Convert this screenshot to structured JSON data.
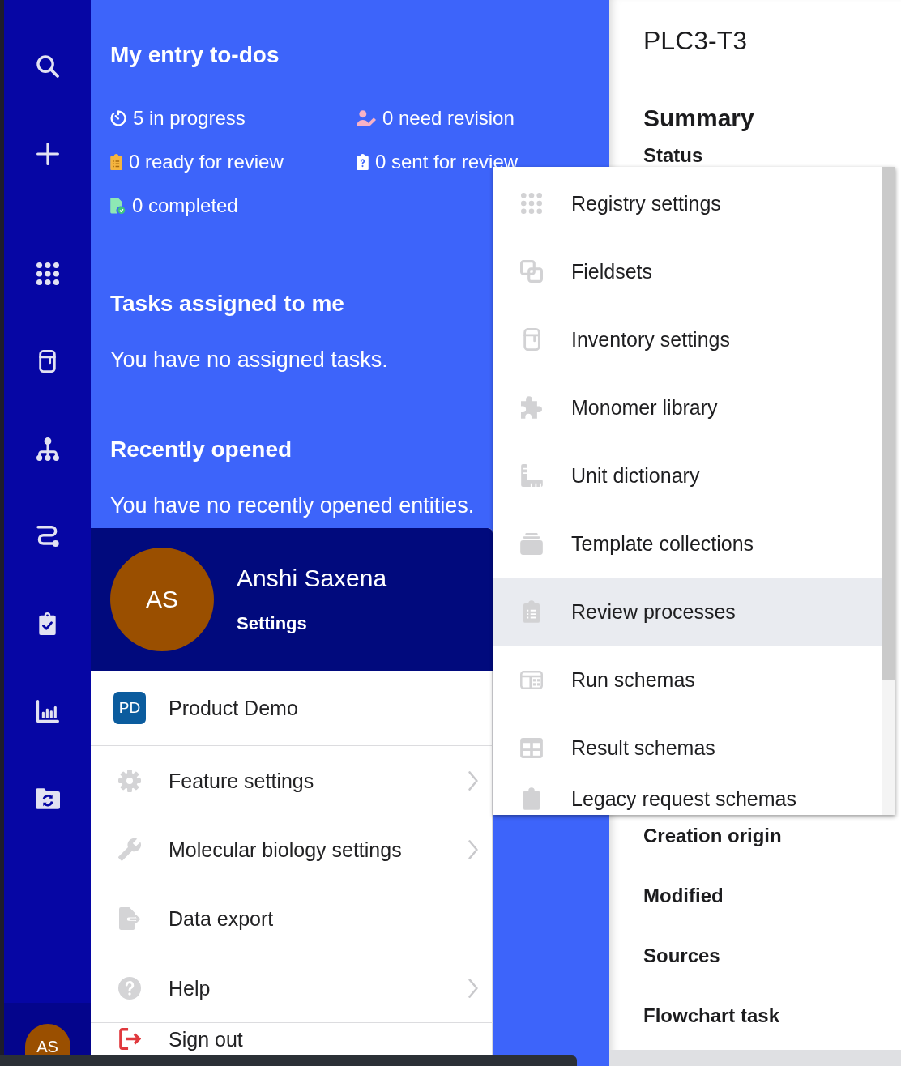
{
  "sidebar": {
    "avatar_initials": "AS"
  },
  "todos": {
    "title": "My entry to-dos",
    "stats": [
      {
        "kind": "progress",
        "label": "5 in progress"
      },
      {
        "kind": "revision",
        "label": "0 need revision"
      },
      {
        "kind": "ready",
        "label": "0 ready for review"
      },
      {
        "kind": "sent",
        "label": "0 sent for review"
      },
      {
        "kind": "completed",
        "label": "0 completed"
      }
    ]
  },
  "tasks": {
    "title": "Tasks assigned to me",
    "empty_text": "You have no assigned tasks."
  },
  "recent": {
    "title": "Recently opened",
    "empty_text": "You have no recently opened entities."
  },
  "entity": {
    "title": "PLC3-T3",
    "section_title": "Summary",
    "fields": [
      {
        "label": "Status"
      },
      {
        "label": "Creation origin"
      },
      {
        "label": "Modified"
      },
      {
        "label": "Sources"
      },
      {
        "label": "Flowchart task"
      }
    ]
  },
  "user_menu": {
    "initials": "AS",
    "name": "Anshi Saxena",
    "settings_link": "Settings",
    "sections": [
      {
        "items": [
          {
            "kind": "organization",
            "badge": "PD",
            "label": "Product Demo",
            "has_submenu": false
          }
        ]
      },
      {
        "items": [
          {
            "kind": "gear",
            "label": "Feature settings",
            "has_submenu": true
          },
          {
            "kind": "wrench",
            "label": "Molecular biology settings",
            "has_submenu": true
          },
          {
            "kind": "export",
            "label": "Data export",
            "has_submenu": false
          }
        ]
      },
      {
        "items": [
          {
            "kind": "help",
            "label": "Help",
            "has_submenu": true
          }
        ]
      },
      {
        "items": [
          {
            "kind": "signout",
            "label": "Sign out",
            "has_submenu": false
          }
        ]
      }
    ]
  },
  "settings_menu": {
    "items": [
      {
        "kind": "dots",
        "label": "Registry settings",
        "selected": false
      },
      {
        "kind": "squares",
        "label": "Fieldsets",
        "selected": false
      },
      {
        "kind": "cabinet",
        "label": "Inventory settings",
        "selected": false
      },
      {
        "kind": "puzzle",
        "label": "Monomer library",
        "selected": false
      },
      {
        "kind": "ruler",
        "label": "Unit dictionary",
        "selected": false
      },
      {
        "kind": "stack",
        "label": "Template collections",
        "selected": false
      },
      {
        "kind": "clipboard",
        "label": "Review processes",
        "selected": true
      },
      {
        "kind": "card",
        "label": "Run schemas",
        "selected": false
      },
      {
        "kind": "table",
        "label": "Result schemas",
        "selected": false
      },
      {
        "kind": "clipboard",
        "label": "Legacy request schemas",
        "selected": false
      }
    ]
  }
}
